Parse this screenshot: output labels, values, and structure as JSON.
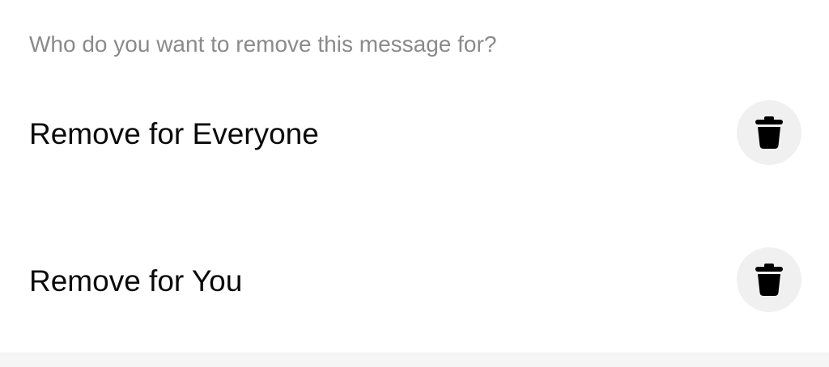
{
  "dialog": {
    "prompt": "Who do you want to remove this message for?",
    "options": [
      {
        "label": "Remove for Everyone",
        "icon": "trash-icon"
      },
      {
        "label": "Remove for You",
        "icon": "trash-icon"
      }
    ]
  },
  "colors": {
    "prompt_text": "#8a8a8a",
    "option_text": "#0a0a0a",
    "icon_bg": "#f0f0f0",
    "icon_fg": "#000000"
  }
}
